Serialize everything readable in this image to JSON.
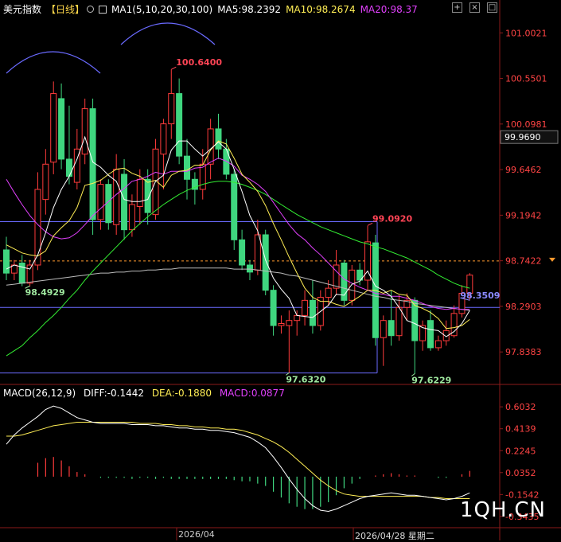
{
  "header": {
    "symbol": "美元指数",
    "period": "【日线】",
    "ma_label": "MA1(5,10,20,30,100)",
    "ma5": "MA5:98.2392",
    "ma10": "MA10:98.2674",
    "ma20": "MA20:98.37"
  },
  "macd_header": {
    "title": "MACD(26,12,9)",
    "diff": "DIFF:-0.1442",
    "dea": "DEA:-0.1880",
    "macd": "MACD:0.0877"
  },
  "dates": {
    "label1": "2026/04",
    "label2": "2026/04/28 星期二"
  },
  "watermark": "1QH.CN",
  "colors": {
    "up": "#ff3b3b",
    "down": "#3fd67f",
    "ma5": "#ffffff",
    "ma10": "#ffee55",
    "ma20": "#e040fb",
    "ma30": "#33ee33",
    "ma100": "#bbbbbb",
    "box": "#6b6bff",
    "arc": "#6a6aff"
  },
  "chart_data": [
    {
      "type": "candlestick",
      "y_axis_ticks": [
        "101.0021",
        "100.5501",
        "100.0981",
        "99.6462",
        "99.1942",
        "98.7422",
        "98.2903",
        "97.8383"
      ],
      "ylim": [
        97.54,
        101.17
      ],
      "current_price_tag": "99.9690",
      "last_price_line": 98.74,
      "annotations": [
        {
          "text": "100.6400",
          "value": 100.64,
          "bar": 21
        },
        {
          "text": "98.4929",
          "value": 98.4929,
          "bar": 3
        },
        {
          "text": "99.0920",
          "value": 99.092,
          "bar": 46
        },
        {
          "text": "97.6320",
          "value": 97.632,
          "bar": 36
        },
        {
          "text": "97.6229",
          "value": 97.6229,
          "bar": 52
        },
        {
          "text": "98.3509",
          "value": 98.3509,
          "bar": 59
        }
      ],
      "box_levels": {
        "upper": 99.13,
        "lower": 97.63,
        "middle": 98.28
      },
      "candles": [
        {
          "o": 98.85,
          "h": 98.98,
          "l": 98.55,
          "c": 98.62
        },
        {
          "o": 98.62,
          "h": 98.75,
          "l": 98.55,
          "c": 98.7
        },
        {
          "o": 98.72,
          "h": 98.8,
          "l": 98.49,
          "c": 98.52
        },
        {
          "o": 98.52,
          "h": 98.75,
          "l": 98.49,
          "c": 98.7
        },
        {
          "o": 98.7,
          "h": 99.62,
          "l": 98.65,
          "c": 99.45
        },
        {
          "o": 99.35,
          "h": 99.85,
          "l": 99.2,
          "c": 99.7
        },
        {
          "o": 99.72,
          "h": 100.52,
          "l": 99.6,
          "c": 100.4
        },
        {
          "o": 100.35,
          "h": 100.5,
          "l": 99.65,
          "c": 99.75
        },
        {
          "o": 99.75,
          "h": 100.28,
          "l": 99.5,
          "c": 99.58
        },
        {
          "o": 99.52,
          "h": 100.05,
          "l": 99.45,
          "c": 99.85
        },
        {
          "o": 99.8,
          "h": 100.35,
          "l": 99.7,
          "c": 100.25
        },
        {
          "o": 100.25,
          "h": 100.35,
          "l": 99.0,
          "c": 99.15
        },
        {
          "o": 99.15,
          "h": 99.55,
          "l": 99.05,
          "c": 99.5
        },
        {
          "o": 99.5,
          "h": 99.55,
          "l": 99.05,
          "c": 99.12
        },
        {
          "o": 99.1,
          "h": 99.8,
          "l": 99.0,
          "c": 99.65
        },
        {
          "o": 99.6,
          "h": 99.75,
          "l": 98.95,
          "c": 99.05
        },
        {
          "o": 99.05,
          "h": 99.4,
          "l": 98.98,
          "c": 99.3
        },
        {
          "o": 99.28,
          "h": 99.65,
          "l": 99.1,
          "c": 99.55
        },
        {
          "o": 99.55,
          "h": 99.65,
          "l": 99.1,
          "c": 99.22
        },
        {
          "o": 99.2,
          "h": 99.95,
          "l": 99.15,
          "c": 99.85
        },
        {
          "o": 99.8,
          "h": 100.15,
          "l": 99.45,
          "c": 100.1
        },
        {
          "o": 100.1,
          "h": 100.64,
          "l": 99.95,
          "c": 100.4
        },
        {
          "o": 100.4,
          "h": 100.55,
          "l": 99.7,
          "c": 99.78
        },
        {
          "o": 99.78,
          "h": 99.95,
          "l": 99.35,
          "c": 99.55
        },
        {
          "o": 99.55,
          "h": 99.62,
          "l": 99.3,
          "c": 99.45
        },
        {
          "o": 99.45,
          "h": 99.85,
          "l": 99.35,
          "c": 99.7
        },
        {
          "o": 99.7,
          "h": 100.15,
          "l": 99.55,
          "c": 100.05
        },
        {
          "o": 100.05,
          "h": 100.2,
          "l": 99.75,
          "c": 99.85
        },
        {
          "o": 99.85,
          "h": 99.95,
          "l": 99.55,
          "c": 99.6
        },
        {
          "o": 99.6,
          "h": 99.65,
          "l": 98.85,
          "c": 98.95
        },
        {
          "o": 98.95,
          "h": 99.05,
          "l": 98.65,
          "c": 98.7
        },
        {
          "o": 98.7,
          "h": 98.75,
          "l": 98.55,
          "c": 98.63
        },
        {
          "o": 98.65,
          "h": 99.15,
          "l": 98.6,
          "c": 99.0
        },
        {
          "o": 99.0,
          "h": 99.05,
          "l": 98.4,
          "c": 98.45
        },
        {
          "o": 98.45,
          "h": 98.5,
          "l": 98.0,
          "c": 98.1
        },
        {
          "o": 98.1,
          "h": 98.2,
          "l": 98.02,
          "c": 98.12
        },
        {
          "o": 98.1,
          "h": 98.25,
          "l": 97.63,
          "c": 98.15
        },
        {
          "o": 98.15,
          "h": 98.25,
          "l": 98.0,
          "c": 98.2
        },
        {
          "o": 98.2,
          "h": 98.45,
          "l": 98.1,
          "c": 98.35
        },
        {
          "o": 98.35,
          "h": 98.55,
          "l": 98.02,
          "c": 98.1
        },
        {
          "o": 98.1,
          "h": 98.45,
          "l": 98.05,
          "c": 98.38
        },
        {
          "o": 98.38,
          "h": 98.55,
          "l": 98.3,
          "c": 98.47
        },
        {
          "o": 98.47,
          "h": 98.85,
          "l": 98.4,
          "c": 98.7
        },
        {
          "o": 98.72,
          "h": 98.75,
          "l": 98.3,
          "c": 98.35
        },
        {
          "o": 98.35,
          "h": 98.7,
          "l": 98.3,
          "c": 98.65
        },
        {
          "o": 98.65,
          "h": 98.72,
          "l": 98.5,
          "c": 98.55
        },
        {
          "o": 98.55,
          "h": 99.09,
          "l": 98.45,
          "c": 98.93
        },
        {
          "o": 98.92,
          "h": 99.0,
          "l": 97.9,
          "c": 97.98
        },
        {
          "o": 97.98,
          "h": 98.2,
          "l": 97.7,
          "c": 98.15
        },
        {
          "o": 98.15,
          "h": 98.45,
          "l": 97.9,
          "c": 98.0
        },
        {
          "o": 98.0,
          "h": 98.4,
          "l": 97.95,
          "c": 98.28
        },
        {
          "o": 98.28,
          "h": 98.42,
          "l": 98.15,
          "c": 98.35
        },
        {
          "o": 98.35,
          "h": 98.38,
          "l": 97.62,
          "c": 97.95
        },
        {
          "o": 97.95,
          "h": 98.15,
          "l": 97.85,
          "c": 98.1
        },
        {
          "o": 98.15,
          "h": 98.25,
          "l": 97.85,
          "c": 97.88
        },
        {
          "o": 97.88,
          "h": 98.0,
          "l": 97.85,
          "c": 97.95
        },
        {
          "o": 97.95,
          "h": 98.15,
          "l": 97.9,
          "c": 98.05
        },
        {
          "o": 98.0,
          "h": 98.3,
          "l": 97.98,
          "c": 98.22
        },
        {
          "o": 98.22,
          "h": 98.5,
          "l": 98.18,
          "c": 98.42
        },
        {
          "o": 98.42,
          "h": 98.62,
          "l": 98.35,
          "c": 98.6
        }
      ],
      "ma5": [
        98.66,
        98.7,
        98.68,
        98.66,
        98.8,
        99.02,
        99.27,
        99.45,
        99.58,
        99.75,
        99.97,
        99.72,
        99.67,
        99.59,
        99.53,
        99.35,
        99.33,
        99.33,
        99.35,
        99.53,
        99.59,
        99.84,
        99.93,
        99.93,
        99.85,
        99.78,
        99.85,
        99.92,
        99.85,
        99.65,
        99.43,
        99.19,
        99.04,
        98.75,
        98.57,
        98.46,
        98.37,
        98.2,
        98.19,
        98.18,
        98.24,
        98.3,
        98.41,
        98.4,
        98.51,
        98.54,
        98.64,
        98.49,
        98.45,
        98.39,
        98.28,
        98.15,
        98.12,
        98.08,
        98.06,
        98.05,
        97.99,
        98.04,
        98.12,
        98.25
      ],
      "ma10": [
        98.9,
        98.86,
        98.82,
        98.8,
        98.79,
        98.84,
        98.99,
        99.07,
        99.14,
        99.27,
        99.49,
        99.51,
        99.54,
        99.6,
        99.65,
        99.66,
        99.61,
        99.58,
        99.52,
        99.54,
        99.47,
        99.59,
        99.63,
        99.64,
        99.69,
        99.69,
        99.84,
        99.93,
        99.9,
        99.76,
        99.6,
        99.52,
        99.43,
        99.29,
        99.11,
        98.95,
        98.78,
        98.62,
        98.47,
        98.38,
        98.34,
        98.34,
        98.31,
        98.29,
        98.34,
        98.39,
        98.45,
        98.45,
        98.42,
        98.45,
        98.41,
        98.4,
        98.3,
        98.27,
        98.23,
        98.17,
        98.07,
        98.08,
        98.1,
        98.16
      ],
      "ma20": [
        99.55,
        99.42,
        99.3,
        99.19,
        99.1,
        99.03,
        98.98,
        98.96,
        98.97,
        99.02,
        99.1,
        99.19,
        99.26,
        99.33,
        99.4,
        99.46,
        99.53,
        99.55,
        99.58,
        99.62,
        99.6,
        99.63,
        99.63,
        99.63,
        99.66,
        99.67,
        99.72,
        99.76,
        99.73,
        99.68,
        99.59,
        99.55,
        99.5,
        99.43,
        99.32,
        99.21,
        99.1,
        99.01,
        98.95,
        98.87,
        98.8,
        98.72,
        98.64,
        98.56,
        98.52,
        98.48,
        98.45,
        98.42,
        98.41,
        98.39,
        98.39,
        98.37,
        98.35,
        98.32,
        98.29,
        98.27,
        98.26,
        98.27,
        98.26,
        98.26
      ],
      "ma30": [
        97.8,
        97.85,
        97.9,
        97.98,
        98.05,
        98.13,
        98.2,
        98.28,
        98.37,
        98.45,
        98.55,
        98.64,
        98.72,
        98.8,
        98.88,
        98.96,
        99.04,
        99.11,
        99.18,
        99.24,
        99.3,
        99.35,
        99.4,
        99.44,
        99.47,
        99.5,
        99.52,
        99.53,
        99.53,
        99.52,
        99.5,
        99.47,
        99.44,
        99.4,
        99.35,
        99.3,
        99.25,
        99.2,
        99.16,
        99.12,
        99.08,
        99.05,
        99.02,
        98.99,
        98.96,
        98.93,
        98.91,
        98.88,
        98.86,
        98.83,
        98.8,
        98.77,
        98.73,
        98.69,
        98.65,
        98.6,
        98.56,
        98.52,
        98.49,
        98.47
      ],
      "ma100": [
        98.5,
        98.51,
        98.52,
        98.53,
        98.54,
        98.55,
        98.56,
        98.57,
        98.58,
        98.59,
        98.6,
        98.61,
        98.62,
        98.62,
        98.63,
        98.63,
        98.64,
        98.64,
        98.65,
        98.65,
        98.66,
        98.66,
        98.67,
        98.67,
        98.67,
        98.67,
        98.67,
        98.67,
        98.67,
        98.66,
        98.66,
        98.66,
        98.65,
        98.64,
        98.63,
        98.62,
        98.6,
        98.59,
        98.57,
        98.55,
        98.53,
        98.51,
        98.49,
        98.47,
        98.45,
        98.43,
        98.41,
        98.39,
        98.38,
        98.36,
        98.35,
        98.34,
        98.32,
        98.31,
        98.3,
        98.29,
        98.28,
        98.27,
        98.26,
        98.25
      ]
    },
    {
      "type": "macd",
      "y_axis_ticks": [
        "0.6032",
        "0.4139",
        "0.2245",
        "0.0352",
        "-0.1542",
        "-0.3435"
      ],
      "ylim": [
        -0.42,
        0.68
      ],
      "diff": [
        0.28,
        0.36,
        0.42,
        0.47,
        0.52,
        0.58,
        0.61,
        0.59,
        0.55,
        0.51,
        0.49,
        0.47,
        0.46,
        0.46,
        0.46,
        0.46,
        0.45,
        0.45,
        0.45,
        0.44,
        0.44,
        0.43,
        0.42,
        0.42,
        0.41,
        0.41,
        0.4,
        0.4,
        0.39,
        0.38,
        0.36,
        0.34,
        0.3,
        0.25,
        0.17,
        0.08,
        -0.02,
        -0.11,
        -0.19,
        -0.25,
        -0.29,
        -0.3,
        -0.28,
        -0.25,
        -0.22,
        -0.19,
        -0.17,
        -0.16,
        -0.15,
        -0.14,
        -0.15,
        -0.16,
        -0.16,
        -0.17,
        -0.18,
        -0.19,
        -0.2,
        -0.19,
        -0.17,
        -0.14
      ],
      "dea": [
        0.35,
        0.35,
        0.36,
        0.38,
        0.4,
        0.42,
        0.44,
        0.45,
        0.46,
        0.47,
        0.47,
        0.47,
        0.47,
        0.47,
        0.47,
        0.47,
        0.47,
        0.46,
        0.46,
        0.46,
        0.45,
        0.45,
        0.44,
        0.44,
        0.43,
        0.43,
        0.42,
        0.42,
        0.41,
        0.41,
        0.4,
        0.38,
        0.36,
        0.33,
        0.3,
        0.26,
        0.21,
        0.15,
        0.09,
        0.03,
        -0.03,
        -0.08,
        -0.12,
        -0.15,
        -0.16,
        -0.17,
        -0.17,
        -0.17,
        -0.17,
        -0.17,
        -0.17,
        -0.17,
        -0.17,
        -0.17,
        -0.18,
        -0.18,
        -0.19,
        -0.19,
        -0.19,
        -0.19
      ],
      "hist": [
        0.0,
        0.0,
        0.0,
        0.0,
        0.12,
        0.16,
        0.17,
        0.14,
        0.09,
        0.04,
        0.02,
        0.0,
        -0.01,
        -0.01,
        -0.01,
        -0.01,
        -0.02,
        -0.01,
        -0.01,
        -0.02,
        -0.01,
        -0.02,
        -0.02,
        -0.02,
        -0.02,
        -0.02,
        -0.02,
        -0.02,
        -0.02,
        -0.03,
        -0.04,
        -0.04,
        -0.06,
        -0.08,
        -0.13,
        -0.18,
        -0.23,
        -0.26,
        -0.28,
        -0.28,
        -0.26,
        -0.22,
        -0.16,
        -0.1,
        -0.06,
        -0.02,
        0.0,
        0.01,
        0.02,
        0.03,
        0.02,
        0.01,
        0.01,
        0.0,
        0.0,
        -0.01,
        -0.01,
        0.0,
        0.02,
        0.05
      ]
    }
  ]
}
